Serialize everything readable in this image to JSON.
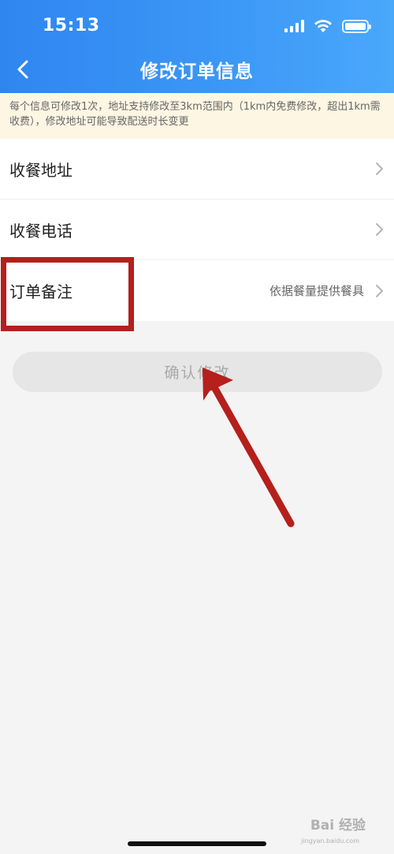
{
  "status_bar": {
    "time": "15:13"
  },
  "header": {
    "title": "修改订单信息"
  },
  "notice": {
    "text": "每个信息可修改1次，地址支持修改至3km范围内（1km内免费修改，超出1km需收费），修改地址可能导致配送时长变更"
  },
  "list": {
    "items": [
      {
        "label": "收餐地址",
        "value": ""
      },
      {
        "label": "收餐电话",
        "value": ""
      },
      {
        "label": "订单备注",
        "value": "依据餐量提供餐具"
      }
    ]
  },
  "confirm": {
    "label": "确认修改"
  },
  "watermark": {
    "text": "Bai 经验",
    "sub": "jingyan.baidu.com"
  },
  "colors": {
    "header_start": "#2f86f0",
    "header_end": "#4aa8fb",
    "notice_bg": "#fdf6e3",
    "annotation_red": "#b51f1c",
    "button_disabled": "#e6e6e6"
  },
  "icons": {
    "back": "chevron-left-icon",
    "row_arrow": "chevron-right-icon",
    "signal": "signal-icon",
    "wifi": "wifi-icon",
    "battery": "battery-icon"
  }
}
